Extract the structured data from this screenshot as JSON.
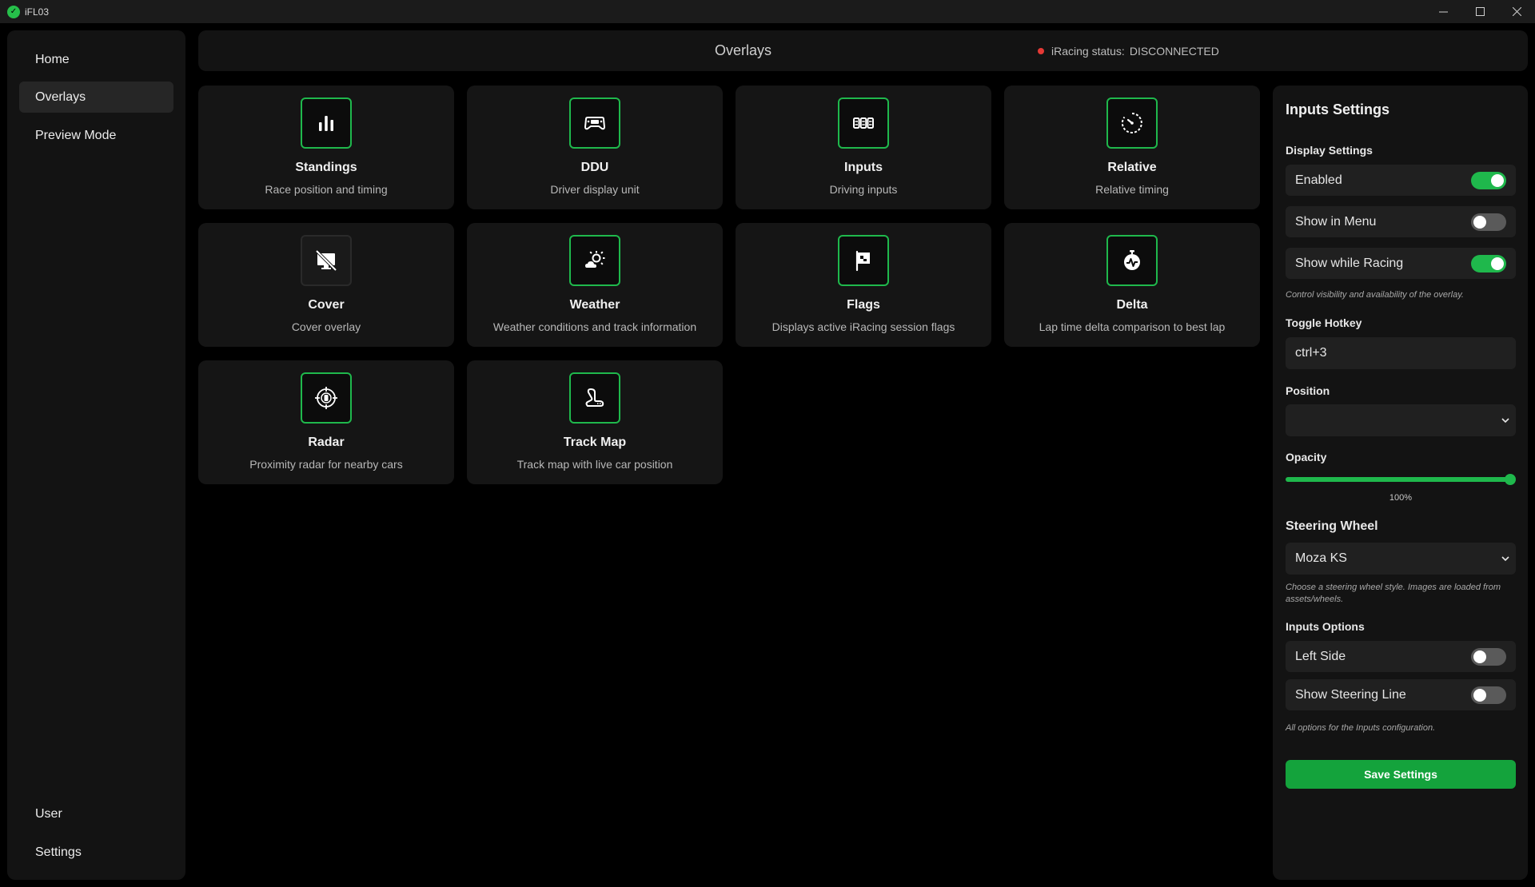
{
  "window": {
    "title": "iFL03"
  },
  "sidebar": {
    "top_items": [
      {
        "label": "Home",
        "active": false
      },
      {
        "label": "Overlays",
        "active": true
      },
      {
        "label": "Preview Mode",
        "active": false
      }
    ],
    "bottom_items": [
      {
        "label": "User"
      },
      {
        "label": "Settings"
      }
    ]
  },
  "header": {
    "title": "Overlays",
    "status_label": "iRacing status:",
    "status_value": "DISCONNECTED",
    "status_color": "#e53935"
  },
  "overlays": [
    {
      "title": "Standings",
      "desc": "Race position and timing",
      "icon": "bar-chart-icon"
    },
    {
      "title": "DDU",
      "desc": "Driver display unit",
      "icon": "gamepad-icon"
    },
    {
      "title": "Inputs",
      "desc": "Driving inputs",
      "icon": "pedals-icon"
    },
    {
      "title": "Relative",
      "desc": "Relative timing",
      "icon": "timer-icon"
    },
    {
      "title": "Cover",
      "desc": "Cover overlay",
      "icon": "monitor-off-icon"
    },
    {
      "title": "Weather",
      "desc": "Weather conditions and track information",
      "icon": "weather-icon"
    },
    {
      "title": "Flags",
      "desc": "Displays active iRacing session flags",
      "icon": "flag-icon"
    },
    {
      "title": "Delta",
      "desc": "Lap time delta comparison to best lap",
      "icon": "stopwatch-icon"
    },
    {
      "title": "Radar",
      "desc": "Proximity radar for nearby cars",
      "icon": "radar-icon"
    },
    {
      "title": "Track Map",
      "desc": "Track map with live car position",
      "icon": "track-map-icon"
    }
  ],
  "settings": {
    "title": "Inputs Settings",
    "display_settings_label": "Display Settings",
    "toggles": [
      {
        "label": "Enabled",
        "on": true
      },
      {
        "label": "Show in Menu",
        "on": false
      },
      {
        "label": "Show while Racing",
        "on": true
      }
    ],
    "display_hint": "Control visibility and availability of the overlay.",
    "hotkey_label": "Toggle Hotkey",
    "hotkey_value": "ctrl+3",
    "position_label": "Position",
    "position_value": "",
    "opacity_label": "Opacity",
    "opacity_value": "100%",
    "opacity_fraction": 1.0,
    "wheel_label": "Steering Wheel",
    "wheel_value": "Moza KS",
    "wheel_hint": "Choose a steering wheel style. Images are loaded from assets/wheels.",
    "inputs_options_label": "Inputs Options",
    "inputs_toggles": [
      {
        "label": "Left Side",
        "on": false
      },
      {
        "label": "Show Steering Line",
        "on": false
      }
    ],
    "inputs_hint": "All options for the Inputs configuration.",
    "save_label": "Save Settings"
  },
  "colors": {
    "accent": "#1fb84c",
    "save_button": "#14a33c"
  }
}
